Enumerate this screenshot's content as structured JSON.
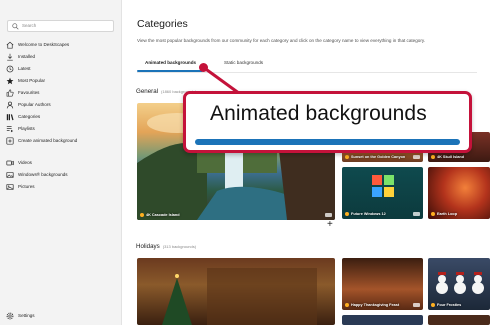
{
  "app": {
    "accent": "#c4123a",
    "tab_accent": "#1b73b8"
  },
  "sidebar": {
    "search_placeholder": "Search",
    "items": [
      {
        "label": "Welcome to DeskScapes",
        "icon": "home-icon"
      },
      {
        "label": "Installed",
        "icon": "download-icon"
      },
      {
        "label": "Latest",
        "icon": "clock-icon"
      },
      {
        "label": "Most Popular",
        "icon": "star-icon"
      },
      {
        "label": "Favourites",
        "icon": "thumbs-up-icon"
      },
      {
        "label": "Popular Authors",
        "icon": "person-icon"
      },
      {
        "label": "Categories",
        "icon": "library-icon"
      },
      {
        "label": "Playlists",
        "icon": "playlist-icon"
      },
      {
        "label": "Create animated background",
        "icon": "add-square-icon"
      },
      {
        "label": "Videos",
        "icon": "video-icon"
      },
      {
        "label": "Windows® backgrounds",
        "icon": "image-icon"
      },
      {
        "label": "Pictures",
        "icon": "picture-icon"
      }
    ],
    "settings_label": "Settings"
  },
  "main": {
    "title": "Categories",
    "subtitle": "View the most popular backgrounds from our community for each category and click on the category name to view everything in that category.",
    "tabs": [
      {
        "label": "Animated backgrounds",
        "active": true
      },
      {
        "label": "Static backgrounds",
        "active": false
      }
    ],
    "sections": [
      {
        "title": "General",
        "count": "(1860 backgrounds)",
        "tiles": [
          {
            "label": "4K Cascade Island"
          },
          {
            "label": "Sunset on the Golden Canyon"
          },
          {
            "label": "4K Skull Island"
          },
          {
            "label": "Future Windows 12"
          },
          {
            "label": "Earth Loop"
          }
        ]
      },
      {
        "title": "Holidays",
        "count": "(313 backgrounds)",
        "tiles": [
          {
            "label": "Happy Thanksgiving Feast"
          },
          {
            "label": "Four Frosties"
          }
        ]
      }
    ],
    "plus": "+"
  },
  "callout": {
    "text": "Animated backgrounds"
  }
}
